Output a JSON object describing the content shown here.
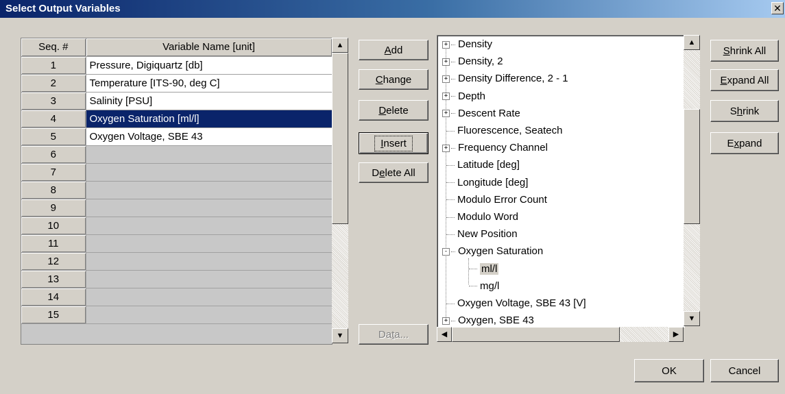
{
  "window": {
    "title": "Select Output Variables",
    "close_glyph": "✕"
  },
  "grid": {
    "headers": {
      "seq": "Seq. #",
      "name": "Variable Name [unit]"
    },
    "rows": [
      {
        "seq": "1",
        "name": "Pressure, Digiquartz [db]"
      },
      {
        "seq": "2",
        "name": "Temperature [ITS-90, deg C]"
      },
      {
        "seq": "3",
        "name": "Salinity [PSU]"
      },
      {
        "seq": "4",
        "name": "Oxygen Saturation [ml/l]",
        "selected": true
      },
      {
        "seq": "5",
        "name": "Oxygen Voltage, SBE 43"
      },
      {
        "seq": "6",
        "name": ""
      },
      {
        "seq": "7",
        "name": ""
      },
      {
        "seq": "8",
        "name": ""
      },
      {
        "seq": "9",
        "name": ""
      },
      {
        "seq": "10",
        "name": ""
      },
      {
        "seq": "11",
        "name": ""
      },
      {
        "seq": "12",
        "name": ""
      },
      {
        "seq": "13",
        "name": ""
      },
      {
        "seq": "14",
        "name": ""
      },
      {
        "seq": "15",
        "name": ""
      }
    ]
  },
  "buttons": {
    "add": {
      "mn": "A",
      "rest": "dd"
    },
    "change": {
      "mn": "C",
      "rest": "hange"
    },
    "delete": {
      "mn": "D",
      "rest": "elete"
    },
    "insert": {
      "mn": "I",
      "rest": "nsert"
    },
    "delete_all": {
      "pre": "D",
      "mn": "e",
      "rest": "lete All"
    },
    "data": {
      "pre": "Da",
      "mn": "t",
      "rest": "a..."
    },
    "shrink_all": {
      "mn": "S",
      "rest": "hrink All"
    },
    "expand_all": {
      "mn": "E",
      "rest": "xpand All"
    },
    "shrink": {
      "pre": "S",
      "mn": "h",
      "rest": "rink"
    },
    "expand": {
      "pre": "E",
      "mn": "x",
      "rest": "pand"
    },
    "ok": "OK",
    "cancel": "Cancel"
  },
  "tree": {
    "items": [
      {
        "label": "Density",
        "node": "+"
      },
      {
        "label": "Density, 2",
        "node": "+"
      },
      {
        "label": "Density Difference, 2 - 1",
        "node": "+"
      },
      {
        "label": "Depth",
        "node": "+"
      },
      {
        "label": "Descent Rate",
        "node": "+"
      },
      {
        "label": "Fluorescence, Seatech",
        "node": ""
      },
      {
        "label": "Frequency Channel",
        "node": "+"
      },
      {
        "label": "Latitude [deg]",
        "node": ""
      },
      {
        "label": "Longitude [deg]",
        "node": ""
      },
      {
        "label": "Modulo Error Count",
        "node": ""
      },
      {
        "label": "Modulo Word",
        "node": ""
      },
      {
        "label": "New Position",
        "node": ""
      },
      {
        "label": "Oxygen Saturation",
        "node": "-"
      },
      {
        "label": "ml/l",
        "node": "",
        "child": true,
        "highlight": true
      },
      {
        "label": "mg/l",
        "node": "",
        "child": true
      },
      {
        "label": "Oxygen Voltage, SBE 43 [V]",
        "node": ""
      },
      {
        "label": "Oxygen, SBE 43",
        "node": "+"
      }
    ]
  },
  "icons": {
    "arrow_up": "▲",
    "arrow_down": "▼",
    "arrow_left": "◀",
    "arrow_right": "▶"
  }
}
